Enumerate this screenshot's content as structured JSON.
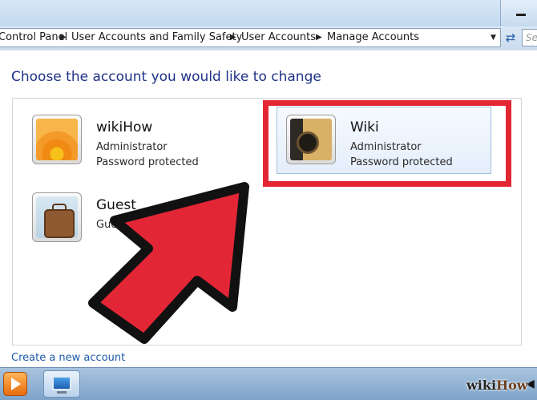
{
  "address_bar": {
    "breadcrumbs": [
      "Control Panel",
      "User Accounts and Family Safety",
      "User Accounts",
      "Manage Accounts"
    ],
    "search_placeholder": "Se"
  },
  "main": {
    "title": "Choose the account you would like to change",
    "accounts": [
      {
        "name": "wikiHow",
        "role": "Administrator",
        "status": "Password protected",
        "picture": "flower-icon"
      },
      {
        "name": "Wiki",
        "role": "Administrator",
        "status": "Password protected",
        "picture": "guitar-icon"
      },
      {
        "name": "Guest",
        "role": "Guest account is off",
        "picture": "luggage-icon"
      }
    ],
    "create_link": "Create a new account"
  },
  "annotation": {
    "highlight_color": "#e32633",
    "arrow_color": "#e32636"
  },
  "watermark": {
    "part1": "wiki",
    "part2": "How"
  }
}
